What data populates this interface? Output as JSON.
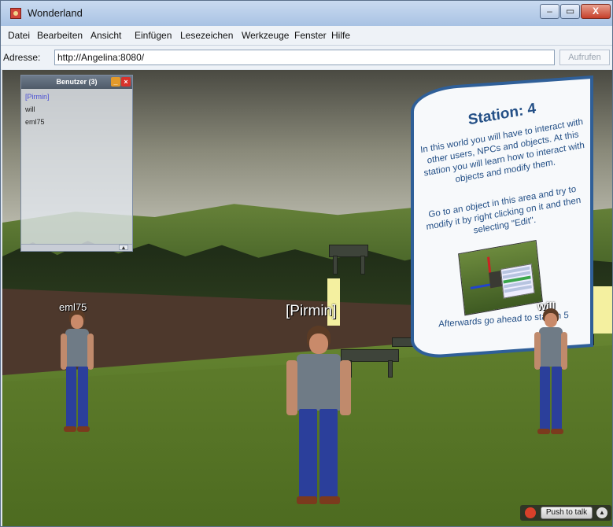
{
  "window": {
    "title": "Wonderland",
    "min_label": "–",
    "max_label": "▭",
    "close_label": "X"
  },
  "menu": [
    "Datei",
    "Bearbeiten",
    "Ansicht",
    "Einfügen",
    "Lesezeichen",
    "Werkzeuge",
    "Fenster",
    "Hilfe"
  ],
  "address": {
    "label": "Adresse:",
    "value": "http://Angelina:8080/",
    "button": "Aufrufen"
  },
  "users_panel": {
    "title": "Benutzer (3)",
    "users": [
      "[Pirmin]",
      "will",
      "eml75"
    ]
  },
  "sign": {
    "title": "Station: 4",
    "para1": "In this world you will have to interact with other users, NPCs and objects. At this station you will learn how to interact with objects and modify them.",
    "para2": "Go to an object in this area and try to modify it by right clicking on it and then selecting \"Edit\".",
    "footer": "Afterwards go ahead to station 5"
  },
  "avatars": {
    "left": "eml75",
    "center": "[Pirmin]",
    "right": "will"
  },
  "voice": {
    "button": "Push to talk",
    "arrow": "▲"
  }
}
